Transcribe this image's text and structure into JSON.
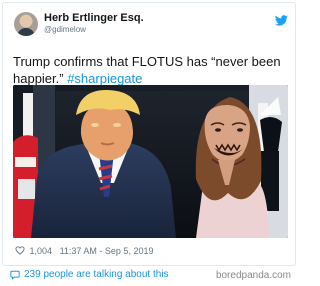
{
  "user": {
    "name": "Herb Ertlinger Esq.",
    "handle": "@gdimelow"
  },
  "tweet": {
    "text": "Trump confirms that FLOTUS has “never been happier.” ",
    "hashtag": "#sharpiegate"
  },
  "stats": {
    "likes": "1,004",
    "timestamp": "11:37 AM - Sep 5, 2019"
  },
  "footer": {
    "talking": "239 people are talking about this",
    "source": "boredpanda.com"
  },
  "colors": {
    "link": "#1b95e0",
    "text": "#14171a",
    "muted": "#657786",
    "twitter_blue": "#1da1f2"
  },
  "icons": {
    "logo": "twitter-bird-icon",
    "likes": "heart-icon",
    "talking": "chat-bubble-icon"
  }
}
